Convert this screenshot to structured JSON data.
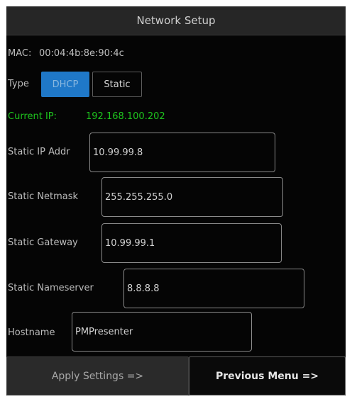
{
  "title": "Network Setup",
  "mac": {
    "label": "MAC:",
    "value": "00:04:4b:8e:90:4c"
  },
  "type": {
    "label": "Type",
    "options": [
      "DHCP",
      "Static"
    ],
    "selected": "DHCP"
  },
  "current_ip": {
    "label": "Current IP:",
    "value": "192.168.100.202"
  },
  "fields": [
    {
      "label": "Static IP Addr",
      "value": "10.99.99.8"
    },
    {
      "label": "Static Netmask",
      "value": "255.255.255.0"
    },
    {
      "label": "Static Gateway",
      "value": "10.99.99.1"
    },
    {
      "label": "Static Nameserver",
      "value": "8.8.8.8"
    },
    {
      "label": "Hostname",
      "value": "PMPresenter"
    }
  ],
  "buttons": {
    "apply": "Apply Settings =>",
    "previous": "Previous Menu =>"
  },
  "colors": {
    "selected_option": "#1f78c8",
    "current_ip": "#1ec41e"
  }
}
